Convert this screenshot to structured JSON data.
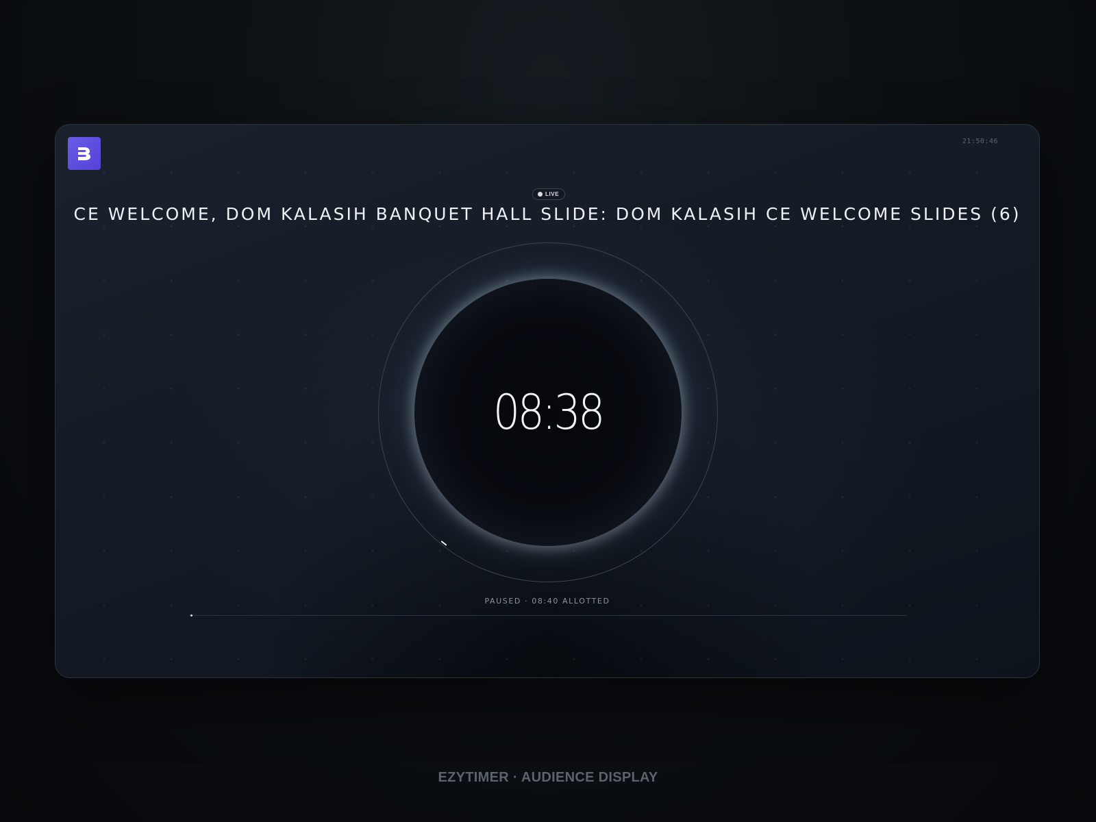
{
  "header": {
    "logo_icon": "brand-logo-icon",
    "clock": "21:50:46"
  },
  "live_badge": {
    "label": "LIVE"
  },
  "session": {
    "title": "CE WELCOME, DOM KALASIH BANQUET HALL SLIDE: DOM KALASIH CE WELCOME SLIDES (6)"
  },
  "timer": {
    "remaining": "08:38",
    "status_text": "PAUSED · 08:40 ALLOTTED",
    "elapsed_fraction": 0.004
  },
  "footer": {
    "label": "EZYTIMER · AUDIENCE DISPLAY"
  },
  "colors": {
    "accent": "#5e4fe0",
    "background": "#0c1014",
    "text": "#eef1f4"
  }
}
